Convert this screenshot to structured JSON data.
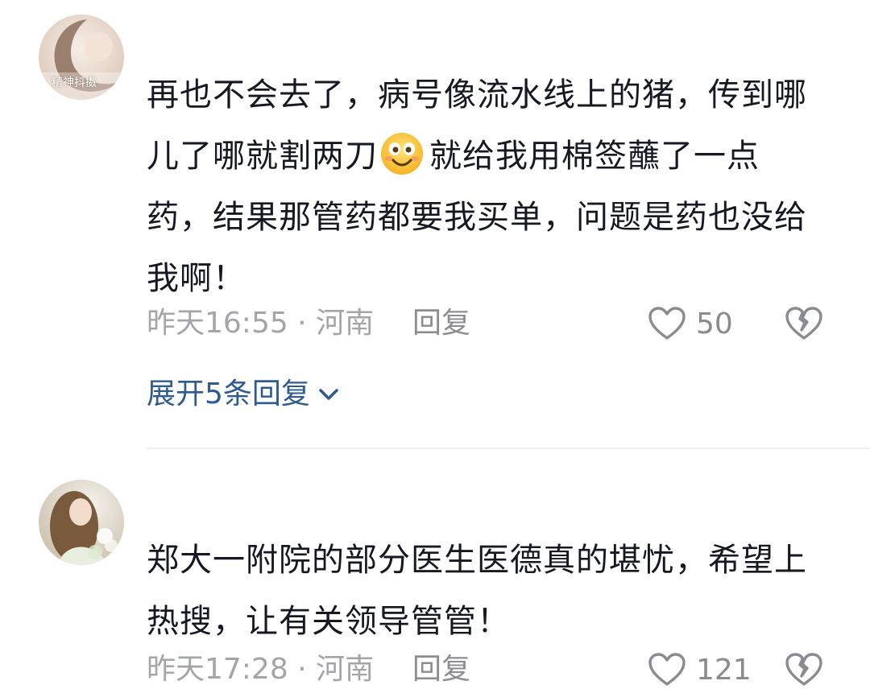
{
  "comments": [
    {
      "username": "",
      "avatar_watermark": "精神抖擞",
      "text_part1": "再也不会去了，病号像流水线上的猪，传到哪儿了哪就割两刀",
      "emoji": "smiling-face-emoji",
      "text_part2": "就给我用棉签蘸了一点药，结果那管药都要我买单，问题是药也没给我啊！",
      "time": "昨天16:55",
      "separator": " · ",
      "location": "河南",
      "reply_label": "回复",
      "likes": "50",
      "expand_label": "展开5条回复"
    },
    {
      "username": "",
      "text": "郑大一附院的部分医生医德真的堪忧，希望上热搜，让有关领导管管！",
      "time": "昨天17:28",
      "separator": " · ",
      "location": "河南",
      "reply_label": "回复",
      "likes": "121"
    }
  ],
  "colors": {
    "text": "#161823",
    "meta": "#a4a5ab",
    "link": "#2e5b92",
    "divider": "#f0f0f2"
  }
}
